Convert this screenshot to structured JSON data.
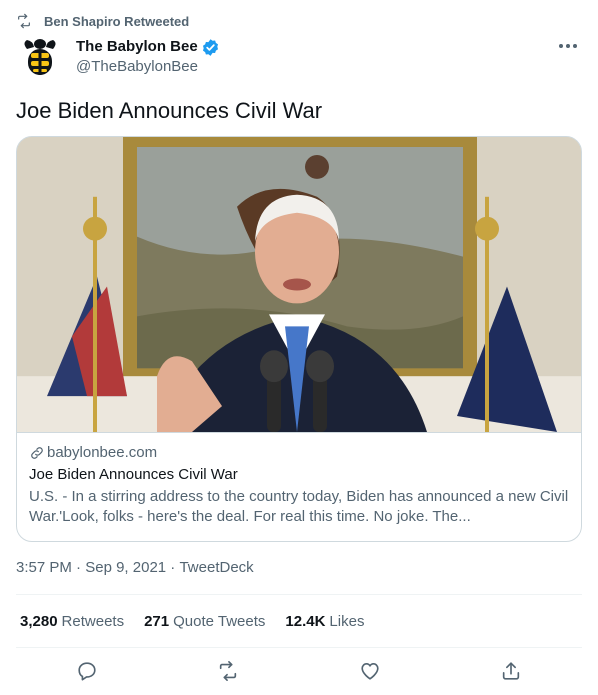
{
  "retweet_context": {
    "text": "Ben Shapiro Retweeted",
    "icon": "retweet-icon"
  },
  "author": {
    "display_name": "The Babylon Bee",
    "handle": "@TheBabylonBee",
    "verified": true,
    "verified_color": "#1d9bf0"
  },
  "tweet": {
    "text": "Joe Biden Announces Civil War"
  },
  "card": {
    "domain": "babylonbee.com",
    "title": "Joe Biden Announces Civil War",
    "description": "U.S. - In a stirring address to the country today, Biden has announced a new Civil War.'Look, folks - here's the deal. For real this time. No joke. The..."
  },
  "meta": {
    "time": "3:57 PM",
    "sep1": " · ",
    "date": "Sep 9, 2021",
    "sep2": " · ",
    "client": "TweetDeck"
  },
  "stats": {
    "retweets": {
      "count": "3,280",
      "label": "Retweets"
    },
    "quotes": {
      "count": "271",
      "label": "Quote Tweets"
    },
    "likes": {
      "count": "12.4K",
      "label": "Likes"
    }
  },
  "colors": {
    "text": "#0f1419",
    "secondary": "#536471",
    "border": "#cfd9de",
    "bee_yellow": "#f7c415"
  }
}
